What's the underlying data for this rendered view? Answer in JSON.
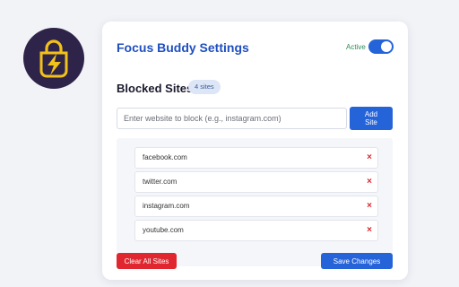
{
  "app": {
    "title": "Focus Buddy Settings",
    "logo_icon": "lightning-lock-icon"
  },
  "status": {
    "label": "Active",
    "enabled": true
  },
  "blocked": {
    "heading": "Blocked Sites",
    "count_label": "4 sites",
    "input_placeholder": "Enter website to block (e.g., instagram.com)",
    "input_value": "",
    "add_label": "Add\nSite",
    "remove_glyph": "×",
    "sites": [
      {
        "name": "facebook.com"
      },
      {
        "name": "twitter.com"
      },
      {
        "name": "instagram.com"
      },
      {
        "name": "youtube.com"
      }
    ]
  },
  "actions": {
    "clear_label": "Clear All Sites",
    "save_label": "Save Changes"
  },
  "colors": {
    "accent": "#2563d9",
    "danger": "#e0262e",
    "title": "#1f4fbf",
    "active": "#2e8b57",
    "logo_bg": "#2e2449",
    "logo_glyph": "#f2c21a"
  }
}
